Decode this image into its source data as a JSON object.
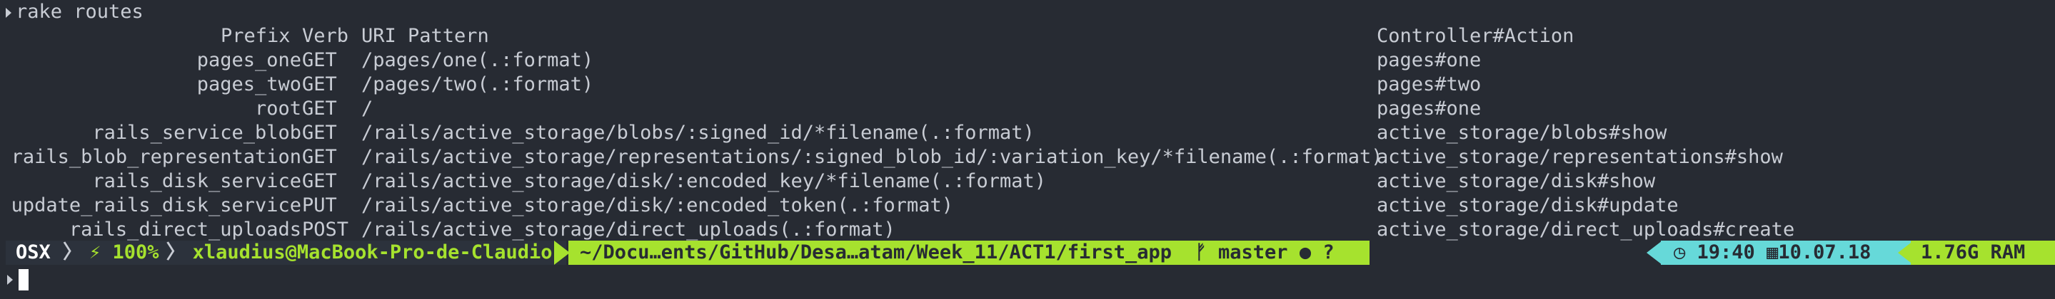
{
  "command": "rake routes",
  "header": {
    "prefix": "Prefix",
    "verb": "Verb",
    "uri": "URI Pattern",
    "action": "Controller#Action"
  },
  "routes": [
    {
      "prefix": "pages_one",
      "verb": "GET",
      "uri": "/pages/one(.:format)",
      "action": "pages#one"
    },
    {
      "prefix": "pages_two",
      "verb": "GET",
      "uri": "/pages/two(.:format)",
      "action": "pages#two"
    },
    {
      "prefix": "root",
      "verb": "GET",
      "uri": "/",
      "action": "pages#one"
    },
    {
      "prefix": "rails_service_blob",
      "verb": "GET",
      "uri": "/rails/active_storage/blobs/:signed_id/*filename(.:format)",
      "action": "active_storage/blobs#show"
    },
    {
      "prefix": "rails_blob_representation",
      "verb": "GET",
      "uri": "/rails/active_storage/representations/:signed_blob_id/:variation_key/*filename(.:format)",
      "action": "active_storage/representations#show"
    },
    {
      "prefix": "rails_disk_service",
      "verb": "GET",
      "uri": "/rails/active_storage/disk/:encoded_key/*filename(.:format)",
      "action": "active_storage/disk#show"
    },
    {
      "prefix": "update_rails_disk_service",
      "verb": "PUT",
      "uri": "/rails/active_storage/disk/:encoded_token(.:format)",
      "action": "active_storage/disk#update"
    },
    {
      "prefix": "rails_direct_uploads",
      "verb": "POST",
      "uri": "/rails/active_storage/direct_uploads(.:format)",
      "action": "active_storage/direct_uploads#create"
    }
  ],
  "status_bar": {
    "os": "OSX",
    "battery": "100%",
    "user_host": "xlaudius@MacBook-Pro-de-Claudio",
    "path": "~/Docu…ents/GitHub/Desa…atam/Week_11/ACT1/first_app",
    "branch": "master",
    "git_status": "● ?",
    "time": "19:40",
    "date": "10.07.18",
    "ram": "1.76G RAM"
  },
  "colors": {
    "background": "#272b33",
    "accent_green": "#a6e22e",
    "accent_cyan": "#66d9d9"
  }
}
